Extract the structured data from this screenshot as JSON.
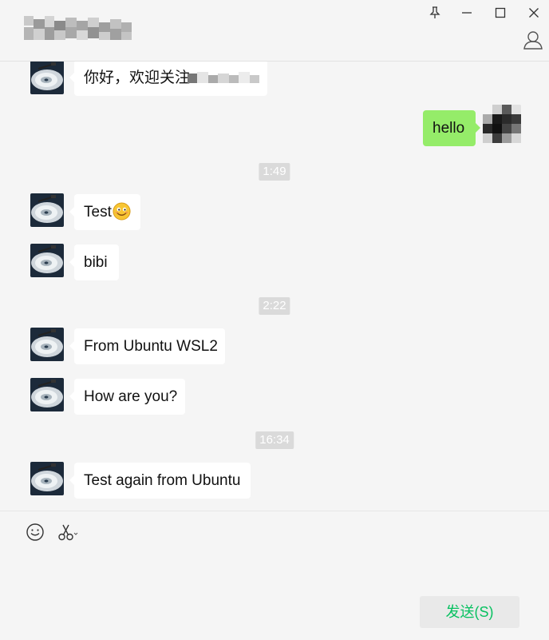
{
  "window": {
    "title_blurred": true,
    "pin_glyph": "⊥",
    "minimize_glyph": "—",
    "maximize_glyph": "☐",
    "close_glyph": "✕"
  },
  "messages": [
    {
      "side": "left",
      "text": "你好，欢迎关注",
      "redacted_tail": true
    },
    {
      "side": "right",
      "text": "hello"
    },
    {
      "type": "time",
      "text": "1:49"
    },
    {
      "side": "left",
      "text": "Test",
      "emoji": "smile"
    },
    {
      "side": "left",
      "text": "bibi"
    },
    {
      "type": "time",
      "text": "2:22"
    },
    {
      "side": "left",
      "text": "From Ubuntu WSL2"
    },
    {
      "side": "left",
      "text": "How are you?"
    },
    {
      "type": "time",
      "text": "16:34"
    },
    {
      "side": "left",
      "text": "Test again from Ubuntu"
    }
  ],
  "toolbar": {
    "emoji_icon": "smile-icon",
    "screenshot_icon": "scissors-icon"
  },
  "send_button": {
    "label": "发送(S)",
    "color": "#07c160"
  },
  "colors": {
    "background": "#f5f5f5",
    "bubble_in": "#ffffff",
    "bubble_out": "#95ec69",
    "timestamp_bg": "#dadada"
  }
}
